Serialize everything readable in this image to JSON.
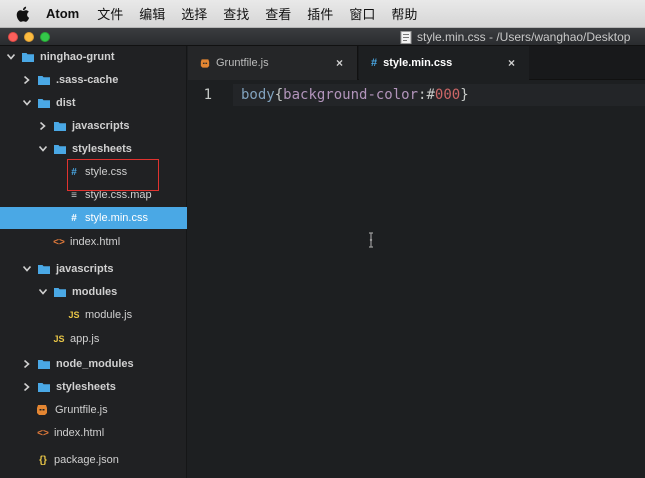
{
  "menubar": {
    "app_name": "Atom",
    "items": [
      "文件",
      "编辑",
      "选择",
      "查找",
      "查看",
      "插件",
      "窗口",
      "帮助"
    ]
  },
  "window": {
    "title": "style.min.css - /Users/wanghao/Desktop"
  },
  "tree": {
    "items": [
      {
        "label": "ninghao-grunt",
        "type": "folder",
        "expanded": true
      },
      {
        "label": ".sass-cache",
        "type": "folder",
        "expanded": false
      },
      {
        "label": "dist",
        "type": "folder",
        "expanded": true
      },
      {
        "label": "javascripts",
        "type": "folder",
        "expanded": false
      },
      {
        "label": "stylesheets",
        "type": "folder",
        "expanded": true
      },
      {
        "label": "style.css",
        "type": "file",
        "icon": "#"
      },
      {
        "label": "style.css.map",
        "type": "file",
        "icon": "≡"
      },
      {
        "label": "style.min.css",
        "type": "file",
        "icon": "#",
        "selected": true
      },
      {
        "label": "index.html",
        "type": "file",
        "icon": "<>"
      },
      {
        "label": "javascripts",
        "type": "folder",
        "expanded": true
      },
      {
        "label": "modules",
        "type": "folder",
        "expanded": true
      },
      {
        "label": "module.js",
        "type": "file",
        "icon": "JS"
      },
      {
        "label": "app.js",
        "type": "file",
        "icon": "JS"
      },
      {
        "label": "node_modules",
        "type": "folder",
        "expanded": false
      },
      {
        "label": "stylesheets",
        "type": "folder",
        "expanded": false
      },
      {
        "label": "Gruntfile.js",
        "type": "file",
        "icon": "grunt"
      },
      {
        "label": "index.html",
        "type": "file",
        "icon": "<>"
      },
      {
        "label": "package.json",
        "type": "file",
        "icon": "{}"
      }
    ]
  },
  "tabs": [
    {
      "label": "Gruntfile.js",
      "icon": "grunt",
      "active": false,
      "close": "×"
    },
    {
      "label": "style.min.css",
      "icon": "#",
      "active": true,
      "close": "×"
    }
  ],
  "editor": {
    "line_number": "1",
    "tokens": {
      "selector": "body",
      "open": "{",
      "property": "background-color",
      "colon": ":",
      "hash": "#",
      "value": "000",
      "close": "}"
    }
  },
  "colors": {
    "selected_row": "#4aa8e5",
    "folder_icon": "#4aa8e5",
    "html_icon": "#e07a3b",
    "js_icon": "#e7c547",
    "json_icon": "#e7c547",
    "css_icon": "#4aa8e5",
    "highlight_box": "#e0332f"
  }
}
